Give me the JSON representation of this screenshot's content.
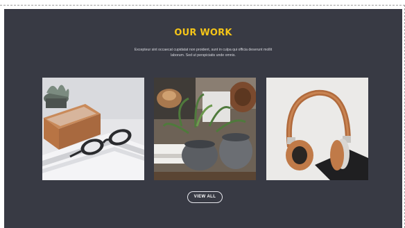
{
  "section": {
    "title": "OUR WORK",
    "description": "Excepteur sint occaecat cupidatat non proident, sunt in culpa qui officia deserunt mollit laborum. Sed ut perspiciatis unde omnis."
  },
  "gallery": {
    "items": [
      {
        "subject": "glasses-on-books-photo"
      },
      {
        "subject": "plants-in-pots-photo"
      },
      {
        "subject": "headphones-photo"
      }
    ]
  },
  "buttons": {
    "view_all_label": "VIEW ALL"
  },
  "colors": {
    "background": "#383a44",
    "title": "#f5c518",
    "text": "#d9dae0",
    "button_border": "#e8e8ee"
  }
}
